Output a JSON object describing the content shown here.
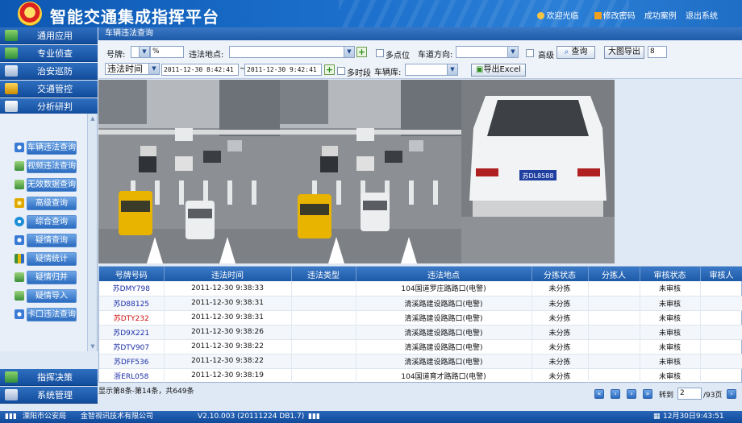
{
  "header": {
    "title": "智能交通集成指挥平台",
    "nav": [
      {
        "label": "欢迎光临",
        "icon": "user-icon"
      },
      {
        "label": "修改密码",
        "icon": "key-icon"
      },
      {
        "label": "成功案例"
      },
      {
        "label": "退出系统"
      }
    ]
  },
  "sidebar": {
    "top_items": [
      "通用应用",
      "专业侦查",
      "治安巡防",
      "交通管控",
      "分析研判"
    ],
    "sub_items": [
      "车辆违法查询",
      "视频违法查询",
      "无效数据查询",
      "高级查询",
      "综合查询",
      "疑情查询",
      "疑情统计",
      "疑情归并",
      "疑情导入",
      "卡口违法查询"
    ],
    "bottom_items": [
      "指挥决策",
      "系统管理"
    ]
  },
  "breadcrumb": "车辆违法查询",
  "filters": {
    "plate_label": "号牌:",
    "plate_value": "%",
    "location_label": "违法地点:",
    "location_value": "",
    "multipoint_label": "多点位",
    "direction_label": "车道方向:",
    "direction_value": "",
    "advanced_label": "高级",
    "search_button": "查询",
    "export_image_button": "大图导出",
    "export_count": "8",
    "time_type": "违法时间",
    "time_start": "2011-12-30 8:42:41",
    "time_sep": "~",
    "time_end": "2011-12-30 9:42:41",
    "multiperiod_label": "多时段",
    "vehicle_db_label": "车辆库:",
    "vehicle_db_value": "",
    "export_excel_button": "导出Excel"
  },
  "photos": {
    "plate_closeup": "苏DL8588"
  },
  "table": {
    "columns": [
      "号牌号码",
      "违法时间",
      "违法类型",
      "违法地点",
      "分拣状态",
      "分拣人",
      "审核状态",
      "审核人"
    ],
    "rows": [
      {
        "plate": "苏DMY798",
        "time": "2011-12-30 9:38:33",
        "type": "",
        "location": "104国道罗庄路路口(电警)",
        "sort_status": "未分拣",
        "sorter": "",
        "audit_status": "未审核",
        "auditor": "",
        "red": false
      },
      {
        "plate": "苏D88125",
        "time": "2011-12-30 9:38:31",
        "type": "",
        "location": "清溪路建设路路口(电警)",
        "sort_status": "未分拣",
        "sorter": "",
        "audit_status": "未审核",
        "auditor": "",
        "red": false
      },
      {
        "plate": "苏DTY232",
        "time": "2011-12-30 9:38:31",
        "type": "",
        "location": "清溪路建设路路口(电警)",
        "sort_status": "未分拣",
        "sorter": "",
        "audit_status": "未审核",
        "auditor": "",
        "red": true
      },
      {
        "plate": "苏D9X221",
        "time": "2011-12-30 9:38:26",
        "type": "",
        "location": "清溪路建设路路口(电警)",
        "sort_status": "未分拣",
        "sorter": "",
        "audit_status": "未审核",
        "auditor": "",
        "red": false
      },
      {
        "plate": "苏DTV907",
        "time": "2011-12-30 9:38:22",
        "type": "",
        "location": "清溪路建设路路口(电警)",
        "sort_status": "未分拣",
        "sorter": "",
        "audit_status": "未审核",
        "auditor": "",
        "red": false
      },
      {
        "plate": "苏DFF536",
        "time": "2011-12-30 9:38:22",
        "type": "",
        "location": "清溪路建设路路口(电警)",
        "sort_status": "未分拣",
        "sorter": "",
        "audit_status": "未审核",
        "auditor": "",
        "red": false
      },
      {
        "plate": "浙ERL058",
        "time": "2011-12-30 9:38:19",
        "type": "",
        "location": "104国道育才路路口(电警)",
        "sort_status": "未分拣",
        "sorter": "",
        "audit_status": "未审核",
        "auditor": "",
        "red": false
      }
    ]
  },
  "pager": {
    "info": "显示第8条-第14条，共649条",
    "goto_label": "转到",
    "page_value": "2",
    "total_label": "/93页"
  },
  "footer": {
    "org": "溧阳市公安局",
    "company": "金智视讯技术有限公司",
    "version": "V2.10.003 (20111224 DB1.7)",
    "datetime": "12月30日9:43:51"
  },
  "colors": {
    "brand_blue": "#0d58b2",
    "header_blue": "#1d5aa8",
    "accent_green": "#2a8a1a",
    "alert_red": "#d01010"
  }
}
